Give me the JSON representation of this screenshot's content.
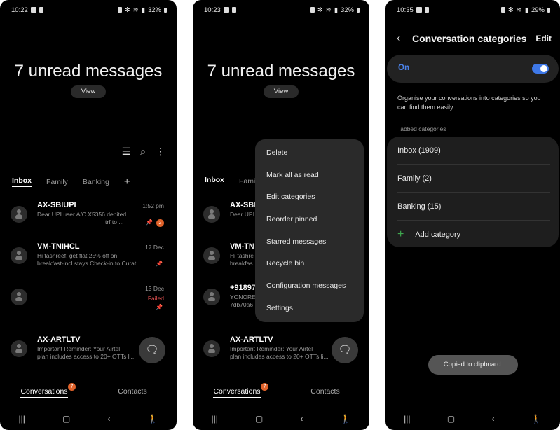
{
  "screens": [
    {
      "status": {
        "time": "10:22",
        "battery": "32%"
      },
      "hero": {
        "title": "7 unread messages",
        "view_label": "View"
      },
      "toolbar": {
        "filter_icon": "filter-icon",
        "search_icon": "search-icon",
        "more_icon": "more-vert-icon"
      },
      "tabs": [
        "Inbox",
        "Family",
        "Banking"
      ],
      "conversations": [
        {
          "sender": "AX-SBIUPI",
          "preview": "Dear UPI user A/C X5356 debited",
          "preview2": "trf to ...",
          "time": "1:52 pm",
          "pinned": true,
          "unread": "2"
        },
        {
          "sender": "VM-TNIHCL",
          "preview": "Hi tashreef, get flat 25% off on",
          "preview2": "breakfast-incl.stays.Check-in to Curat...",
          "time": "17 Dec",
          "pinned": true
        },
        {
          "sender": "",
          "preview": "",
          "time": "13 Dec",
          "status": "Failed",
          "pinned": true
        },
        {
          "sender": "AX-ARTLTV",
          "preview": "Important Reminder: Your Airtel",
          "preview2": "plan includes access to 20+ OTTs li...",
          "time": ""
        }
      ],
      "bottom_tabs": {
        "conversations": "Conversations",
        "conversations_badge": "7",
        "contacts": "Contacts"
      }
    },
    {
      "status": {
        "time": "10:23",
        "battery": "32%"
      },
      "hero": {
        "title": "7 unread messages",
        "view_label": "View"
      },
      "tabs": [
        "Inbox",
        "Famil"
      ],
      "conversations": [
        {
          "sender": "AX-SBI",
          "preview": "Dear UPI"
        },
        {
          "sender": "VM-TN",
          "preview": "Hi tashre",
          "preview2": "breakfas"
        },
        {
          "sender": "+91897",
          "preview": "YONORE",
          "preview2": "7db70a6"
        },
        {
          "sender": "AX-ARTLTV",
          "preview": "Important Reminder: Your Airtel",
          "preview2": "plan includes access to 20+ OTTs li..."
        }
      ],
      "menu": [
        "Delete",
        "Mark all as read",
        "Edit categories",
        "Reorder pinned",
        "Starred messages",
        "Recycle bin",
        "Configuration messages",
        "Settings"
      ],
      "bottom_tabs": {
        "conversations": "Conversations",
        "conversations_badge": "7",
        "contacts": "Contacts"
      }
    },
    {
      "status": {
        "time": "10:35",
        "battery": "29%"
      },
      "header": {
        "title": "Conversation categories",
        "edit_label": "Edit"
      },
      "toggle": {
        "label": "On",
        "enabled": true
      },
      "description": "Organise your conversations into categories so you can find them easily.",
      "section_label": "Tabbed categories",
      "categories": [
        "Inbox (1909)",
        "Family  (2)",
        "Banking (15)"
      ],
      "add_category_label": "Add category",
      "toast": "Copied to clipboard."
    }
  ],
  "colors": {
    "accent_blue": "#3e78e8",
    "badge_orange": "#e0622a",
    "failed_red": "#e25050",
    "add_green": "#3fa84f"
  }
}
